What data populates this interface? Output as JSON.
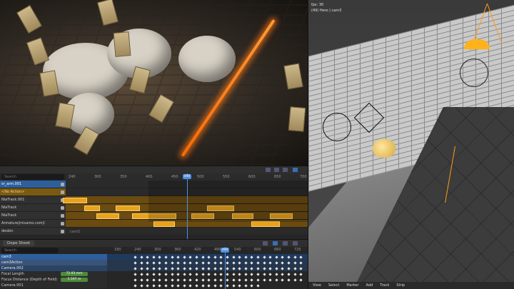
{
  "render": {
    "label": ""
  },
  "viewport3d": {
    "fps": "fps: 30",
    "camera_info": "(49) Hero | cam3",
    "menu": [
      "View",
      "Select",
      "Marker",
      "Add",
      "Track",
      "Strip"
    ]
  },
  "nla": {
    "search_placeholder": "Search",
    "playhead_frame": "490",
    "ticks": [
      "240",
      "300",
      "350",
      "400",
      "450",
      "500",
      "550",
      "600",
      "650",
      "700"
    ],
    "channels": [
      {
        "label": "sr_arm.001",
        "state": "selected"
      },
      {
        "label": "<No Action>",
        "state": "action"
      },
      {
        "label": "NlaTrack.001",
        "state": "normal"
      },
      {
        "label": "NlaTrack",
        "state": "normal"
      },
      {
        "label": "NlaTrack",
        "state": "normal"
      },
      {
        "label": "Armature|mixamo.com|l",
        "state": "normal"
      },
      {
        "label": "desbin",
        "state": "normal"
      }
    ],
    "strips": [
      {
        "row": 2,
        "start": 88,
        "width": 34,
        "label": ""
      },
      {
        "row": 3,
        "start": 118,
        "width": 22,
        "label": ""
      },
      {
        "row": 3,
        "start": 162,
        "width": 34,
        "label": ""
      },
      {
        "row": 3,
        "start": 290,
        "width": 38,
        "label": ""
      },
      {
        "row": 4,
        "start": 135,
        "width": 32,
        "label": ""
      },
      {
        "row": 4,
        "start": 185,
        "width": 62,
        "label": ""
      },
      {
        "row": 4,
        "start": 268,
        "width": 32,
        "label": ""
      },
      {
        "row": 4,
        "start": 325,
        "width": 30,
        "label": ""
      },
      {
        "row": 4,
        "start": 378,
        "width": 32,
        "label": ""
      },
      {
        "row": 5,
        "start": 215,
        "width": 30,
        "label": ""
      },
      {
        "row": 5,
        "start": 352,
        "width": 40,
        "label": ""
      }
    ],
    "dim_label": "cam3"
  },
  "dopesheet": {
    "title": "Dope Sheet",
    "search_placeholder": "Search",
    "playhead_frame": "490",
    "ticks": [
      "180",
      "240",
      "300",
      "360",
      "420",
      "490",
      "540",
      "600",
      "660",
      "720"
    ],
    "channels": [
      {
        "label": "cam3",
        "type": "cam"
      },
      {
        "label": "cam3Action",
        "type": "act"
      },
      {
        "label": "Camera.002",
        "type": "obj"
      },
      {
        "label": "Focal Length",
        "type": "prop",
        "value": "72.93 mm"
      },
      {
        "label": "Focus Distance (Depth of Field)",
        "type": "prop",
        "value": "5.597 m"
      },
      {
        "label": "Camera.001",
        "type": "prop",
        "value": ""
      }
    ]
  }
}
